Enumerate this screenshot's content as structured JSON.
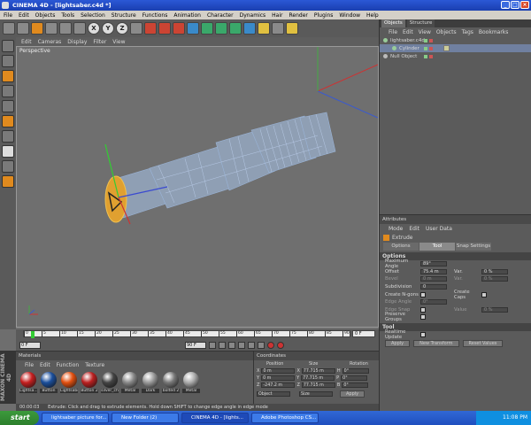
{
  "window": {
    "title": "CINEMA 4D - [lightsaber.c4d *]"
  },
  "menubar": [
    "File",
    "Edit",
    "Objects",
    "Tools",
    "Selection",
    "Structure",
    "Functions",
    "Animation",
    "Character",
    "Dynamics",
    "Hair",
    "Render",
    "Plugins",
    "Window",
    "Help"
  ],
  "viewport": {
    "menu": [
      "Edit",
      "Cameras",
      "Display",
      "Filter",
      "View"
    ],
    "label": "Perspective"
  },
  "objects_panel": {
    "tabs": [
      "Objects",
      "Structure"
    ],
    "menu": [
      "File",
      "Edit",
      "View",
      "Objects",
      "Tags",
      "Bookmarks"
    ],
    "items": [
      "lightsaber.c4d",
      "Cylinder",
      "Null Object"
    ]
  },
  "attributes_panel": {
    "title": "Attributes",
    "menu": [
      "Mode",
      "Edit",
      "User Data"
    ],
    "tool_name": "Extrude",
    "tabs": [
      "Options",
      "Tool",
      "Snap Settings"
    ],
    "options_header": "Options",
    "max_angle_label": "Maximum Angle",
    "max_angle": "89°",
    "offset_label": "Offset",
    "offset": "75.4 m",
    "var_label": "Var.",
    "var_value": "0 %",
    "bevel_label": "Bevel",
    "bevel": "0 m",
    "var2_label": "Var.",
    "var2_value": "0 %",
    "subdivision_label": "Subdivision",
    "subdivision": "0",
    "create_ngons_label": "Create N-gons",
    "create_caps_label": "Create Caps",
    "edge_angle_label": "Edge Angle",
    "edge_angle": "0°",
    "edge_snap_label": "Edge Snap",
    "value_label": "Value",
    "value": "0 %",
    "preserve_groups_label": "Preserve Groups",
    "tool_header": "Tool",
    "realtime_update_label": "Realtime Update",
    "apply_label": "Apply",
    "new_transform_label": "New Transform",
    "reset_values_label": "Reset Values"
  },
  "timeline": {
    "ticks": [
      "0",
      "5",
      "10",
      "15",
      "20",
      "25",
      "30",
      "35",
      "40",
      "45",
      "50",
      "55",
      "60",
      "65",
      "70",
      "75",
      "80",
      "85",
      "90"
    ],
    "frame": "0 F",
    "start": "0 F",
    "end": "90 F"
  },
  "materials_panel": {
    "title": "Materials",
    "menu": [
      "File",
      "Edit",
      "Function",
      "Texture"
    ],
    "items": [
      {
        "name": "Lightsa...",
        "color": "#c62020"
      },
      {
        "name": "Button",
        "color": "#1b4f9c"
      },
      {
        "name": "Lightsaber",
        "color": "#e25010"
      },
      {
        "name": "Button 2",
        "color": "#bb2020"
      },
      {
        "name": "silver_ch",
        "color": "#444444"
      },
      {
        "name": "Metal",
        "color": "#888888"
      },
      {
        "name": "Dark",
        "color": "#999999"
      },
      {
        "name": "bolted 2",
        "color": "#777777"
      },
      {
        "name": "Metal",
        "color": "#aaaaaa"
      }
    ]
  },
  "coordinates_panel": {
    "title": "Coordinates",
    "headers": [
      "Position",
      "Size",
      "Rotation"
    ],
    "rows": [
      {
        "axis": "X",
        "pos": "0 m",
        "size_axis": "X",
        "size": "77.715 m",
        "rot_axis": "H",
        "rot": "0°"
      },
      {
        "axis": "Y",
        "pos": "0 m",
        "size_axis": "Y",
        "size": "77.715 m",
        "rot_axis": "P",
        "rot": "0°"
      },
      {
        "axis": "Z",
        "pos": "-247.2 m",
        "size_axis": "Z",
        "size": "77.715 m",
        "rot_axis": "B",
        "rot": "0°"
      }
    ],
    "mode": "Object",
    "size_mode": "Size",
    "apply_label": "Apply"
  },
  "brand": "MAXON CINEMA 4D",
  "status": {
    "time": "00:00:03",
    "text": "Extrude: Click and drag to extrude elements. Hold down SHIFT to change edge angle in edge mode"
  },
  "taskbar": {
    "start": "start",
    "tasks": [
      "lightsaber picture for...",
      "New Folder (2)",
      "CINEMA 4D - [lights...",
      "Adobe Photoshop CS..."
    ],
    "clock": "11:08 PM"
  }
}
